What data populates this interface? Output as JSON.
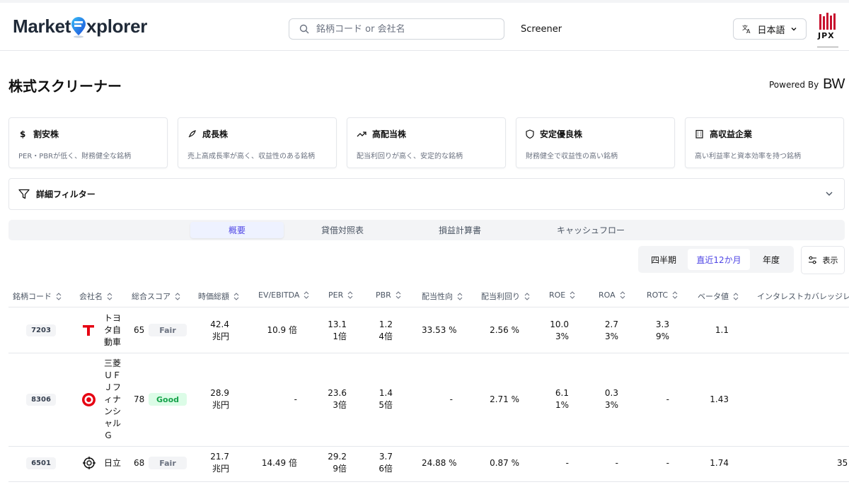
{
  "header": {
    "logo_text_left": "Market",
    "logo_text_right": "xplorer",
    "search_placeholder": "銘柄コード or 会社名",
    "nav_screener": "Screener",
    "language": "日本語",
    "jpx_text": "JPX"
  },
  "page": {
    "title": "株式スクリーナー",
    "powered_by": "Powered By",
    "powered_brand": "BW"
  },
  "cards": [
    {
      "icon": "dollar-icon",
      "title": "割安株",
      "desc": "PER・PBRが低く、財務健全な銘柄"
    },
    {
      "icon": "rocket-icon",
      "title": "成長株",
      "desc": "売上高成長率が高く、収益性のある銘柄"
    },
    {
      "icon": "trending-up-icon",
      "title": "高配当株",
      "desc": "配当利回りが高く、安定的な銘柄"
    },
    {
      "icon": "shield-icon",
      "title": "安定優良株",
      "desc": "財務健全で収益性の高い銘柄"
    },
    {
      "icon": "building-icon",
      "title": "高収益企業",
      "desc": "高い利益率と資本効率を持つ銘柄"
    }
  ],
  "filter": {
    "label": "詳細フィルター"
  },
  "tabs": [
    "概要",
    "貸借対照表",
    "損益計算書",
    "キャッシュフロー"
  ],
  "active_tab": "概要",
  "period": [
    "四半期",
    "直近12か月",
    "年度"
  ],
  "active_period": "直近12か月",
  "show_button": "表示",
  "colors": {
    "accent": "#4f46e5",
    "good": "#16a34a",
    "toyota_red": "#e60012",
    "mufg_red": "#e60012"
  },
  "table": {
    "headers": [
      "銘柄コード",
      "会社名",
      "総合スコア",
      "時価総額",
      "EV/EBITDA",
      "PER",
      "PBR",
      "配当性向",
      "配当利回り",
      "ROE",
      "ROA",
      "ROTC",
      "ベータ値",
      "インタレストカバレッジレシ"
    ],
    "rows": [
      {
        "code": "7203",
        "logo": "toyota-logo-icon",
        "name": "トヨタ自動車",
        "score": "65",
        "grade": "Fair",
        "mcap": "42.4兆円",
        "ev_ebitda": "10.9 倍",
        "per": "13.11倍",
        "pbr": "1.24倍",
        "payout": "33.53 %",
        "yield": "2.56 %",
        "roe": "10.03%",
        "roa": "2.73%",
        "rotc": "3.39%",
        "beta": "1.1",
        "icr": ""
      },
      {
        "code": "8306",
        "logo": "mufg-logo-icon",
        "name": "三菱ＵＦＪフィナンシャルＧ",
        "score": "78",
        "grade": "Good",
        "mcap": "28.9兆円",
        "ev_ebitda": "-",
        "per": "23.63倍",
        "pbr": "1.45倍",
        "payout": "-",
        "yield": "2.71 %",
        "roe": "6.11%",
        "roa": "0.33%",
        "rotc": "-",
        "beta": "1.43",
        "icr": ""
      },
      {
        "code": "6501",
        "logo": "hitachi-logo-icon",
        "name": "日立",
        "score": "68",
        "grade": "Fair",
        "mcap": "21.7兆円",
        "ev_ebitda": "14.49 倍",
        "per": "29.29倍",
        "pbr": "3.76倍",
        "payout": "24.88 %",
        "yield": "0.87 %",
        "roe": "-",
        "roa": "-",
        "rotc": "-",
        "beta": "1.74",
        "icr": "35"
      }
    ]
  }
}
